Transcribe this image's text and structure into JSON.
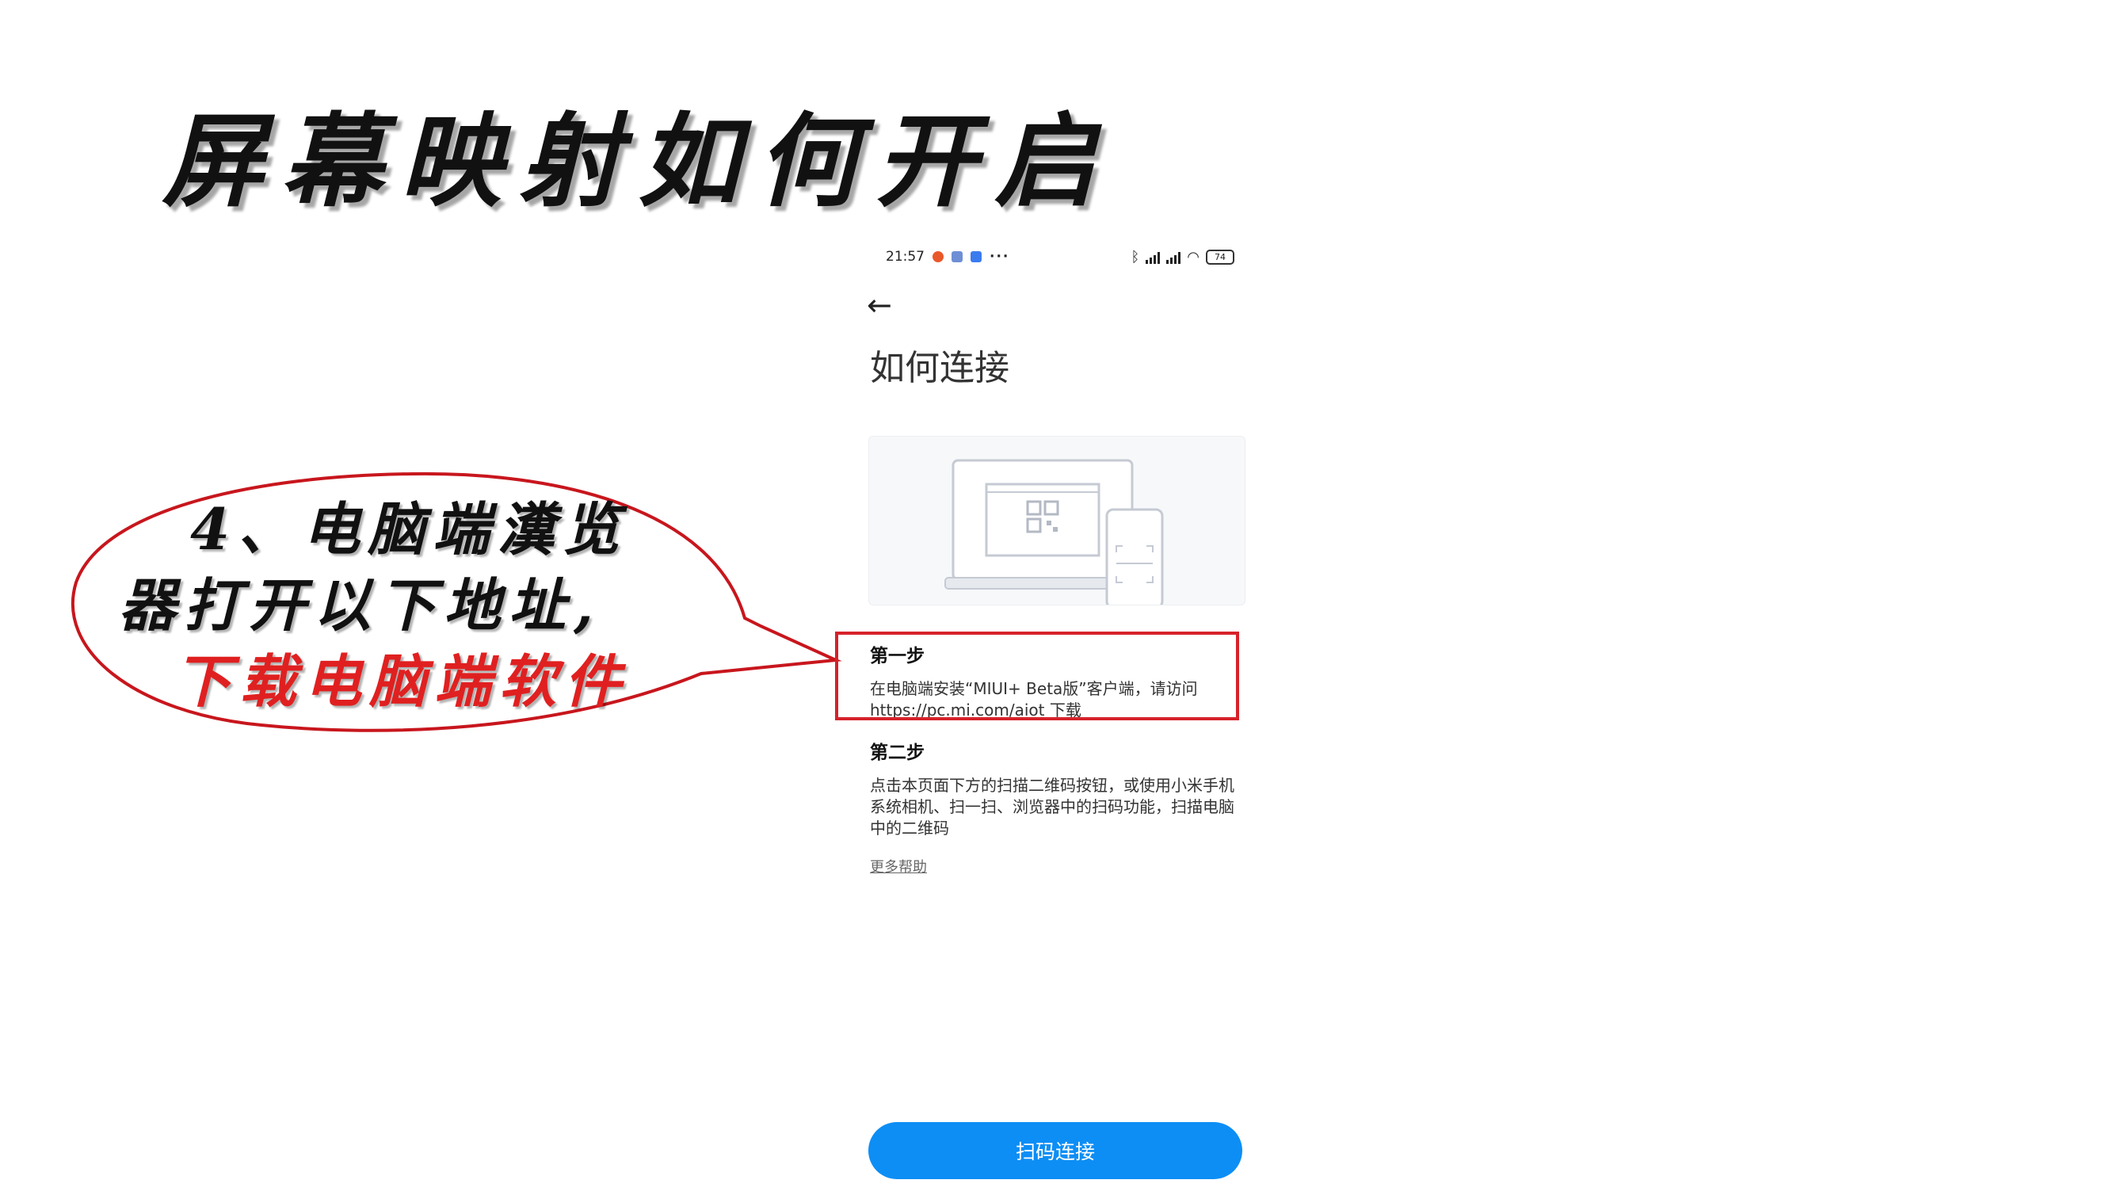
{
  "slide": {
    "title": "屏幕映射如何开启",
    "callout": {
      "line1": "4、电脑端瀵览",
      "line2": "器打开以下地址,",
      "line3": "下载电脑端软件",
      "highlight_color": "#e02020"
    }
  },
  "phone": {
    "status_bar": {
      "time": "21:57",
      "more": "···",
      "battery": "74",
      "icons": [
        "fruit-app-icon",
        "doc-app-icon",
        "blue-app-icon",
        "bluetooth-icon",
        "hd-signal-icon",
        "hd-signal-icon",
        "wifi-icon",
        "battery-icon"
      ]
    },
    "header": {
      "back_icon": "arrow-left-icon",
      "title": "如何连接"
    },
    "illustration": {
      "icons": [
        "laptop-icon",
        "qr-code-icon",
        "phone-icon",
        "scan-frame-icon"
      ]
    },
    "steps": [
      {
        "title": "第一步",
        "body_line1": "在电脑端安装“MIUI+ Beta版”客户端，请访问",
        "body_line2": "https://pc.mi.com/aiot 下载"
      },
      {
        "title": "第二步",
        "body_line1": "点击本页面下方的扫描二维码按钮，或使用小米手机",
        "body_line2": "系统相机、扫一扫、浏览器中的扫码功能，扫描电脑",
        "body_line3": "中的二维码"
      }
    ],
    "help_link": "更多帮助",
    "scan_button": "扫码连接"
  },
  "colors": {
    "accent_blue": "#0d8ef5",
    "highlight_red": "#d6222a"
  }
}
